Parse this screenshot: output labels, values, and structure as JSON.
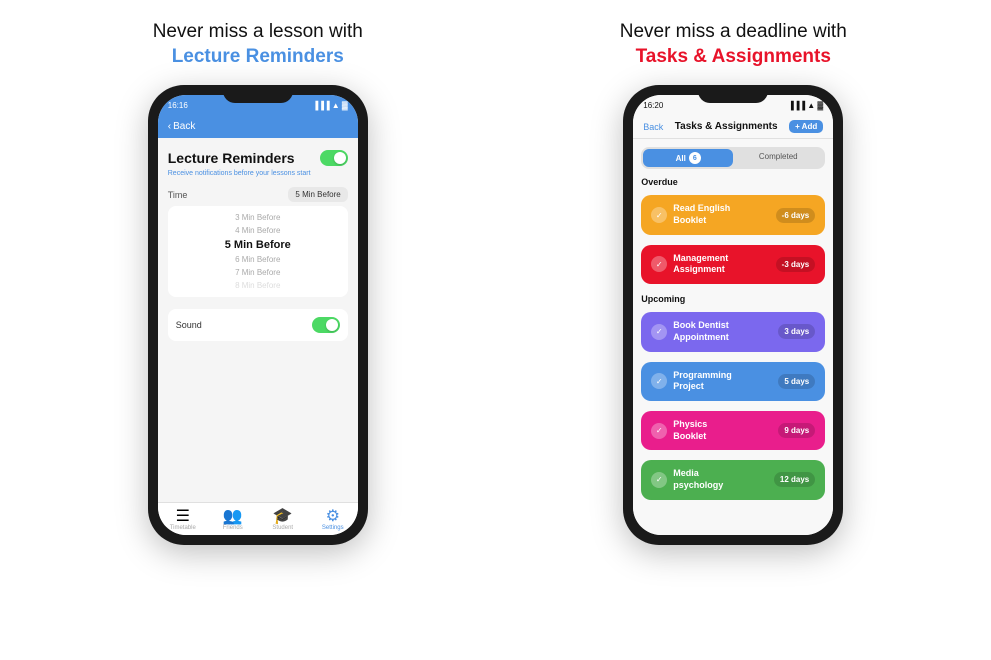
{
  "left": {
    "headline_pre": "Never miss a lesson with",
    "headline_highlight": "Lecture Reminders",
    "headline_color": "blue",
    "phone": {
      "status_time": "16:16",
      "signal": "▐▐▐",
      "wifi": "▲",
      "battery": "▓▓",
      "back_label": "Back",
      "screen_title": "Lecture Reminders",
      "subtitle": "Receive notifications before your lessons start",
      "time_label": "Time",
      "time_badge": "5 Min Before",
      "time_options": [
        "3 Min Before",
        "4 Min Before",
        "5 Min Before",
        "6 Min Before",
        "7 Min Before",
        "8 Min Before"
      ],
      "selected_time": "5 Min Before",
      "sound_label": "Sound",
      "tabs": [
        "Timetable",
        "Friends",
        "Student",
        "Settings"
      ],
      "active_tab": "Settings"
    }
  },
  "right": {
    "headline_pre": "Never miss a deadline with",
    "headline_highlight": "Tasks & Assignments",
    "headline_color": "red",
    "phone": {
      "status_time": "16:20",
      "back_label": "Back",
      "screen_title": "Tasks & Assignments",
      "add_label": "+ Add",
      "filter_all": "All",
      "filter_count": "6",
      "filter_completed": "Completed",
      "overdue_label": "Overdue",
      "upcoming_label": "Upcoming",
      "tasks": [
        {
          "name": "Read English Booklet",
          "days": "-6 days",
          "color": "orange",
          "group": "overdue"
        },
        {
          "name": "Management Assignment",
          "days": "-3 days",
          "color": "red",
          "group": "overdue"
        },
        {
          "name": "Book Dentist Appointment",
          "days": "3 days",
          "color": "purple",
          "group": "upcoming"
        },
        {
          "name": "Programming Project",
          "days": "5 days",
          "color": "blue",
          "group": "upcoming"
        },
        {
          "name": "Physics Booklet",
          "days": "9 days",
          "color": "pink",
          "group": "upcoming"
        },
        {
          "name": "Media psychology",
          "days": "12 days",
          "color": "green",
          "group": "upcoming"
        }
      ]
    }
  }
}
